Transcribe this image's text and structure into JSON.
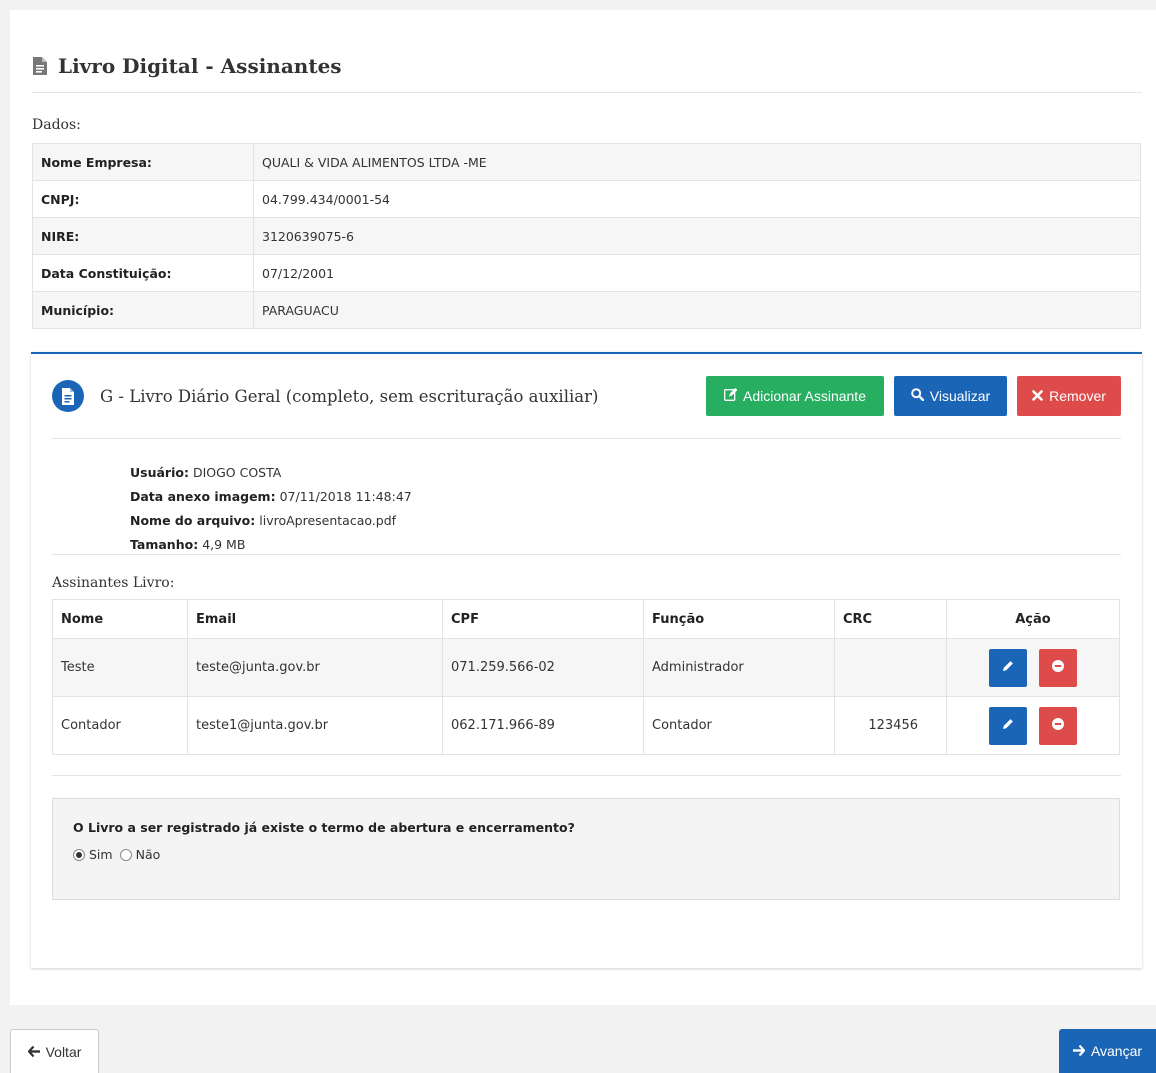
{
  "page": {
    "title": "Livro Digital - Assinantes"
  },
  "dados": {
    "label": "Dados:",
    "rows": [
      {
        "key": "Nome Empresa:",
        "value": "QUALI & VIDA ALIMENTOS LTDA -ME"
      },
      {
        "key": "CNPJ:",
        "value": "04.799.434/0001-54"
      },
      {
        "key": "NIRE:",
        "value": "3120639075-6"
      },
      {
        "key": "Data Constituição:",
        "value": "07/12/2001"
      },
      {
        "key": "Município:",
        "value": "PARAGUACU"
      }
    ]
  },
  "book": {
    "title": "G - Livro Diário Geral (completo, sem escrituração auxiliar)",
    "buttons": {
      "add": "Adicionar Assinante",
      "view": "Visualizar",
      "remove": "Remover"
    },
    "file": {
      "usuario_label": "Usuário:",
      "usuario": "DIOGO COSTA",
      "data_label": "Data anexo imagem:",
      "data": "07/11/2018 11:48:47",
      "arquivo_label": "Nome do arquivo:",
      "arquivo": "livroApresentacao.pdf",
      "tamanho_label": "Tamanho:",
      "tamanho": "4,9 MB"
    }
  },
  "assinantes": {
    "label": "Assinantes Livro:",
    "headers": {
      "nome": "Nome",
      "email": "Email",
      "cpf": "CPF",
      "funcao": "Função",
      "crc": "CRC",
      "acao": "Ação"
    },
    "rows": [
      {
        "nome": "Teste",
        "email": "teste@junta.gov.br",
        "cpf": "071.259.566-02",
        "funcao": "Administrador",
        "crc": ""
      },
      {
        "nome": "Contador",
        "email": "teste1@junta.gov.br",
        "cpf": "062.171.966-89",
        "funcao": "Contador",
        "crc": "123456"
      }
    ]
  },
  "termo": {
    "question": "O Livro a ser registrado já existe o termo de abertura e encerramento?",
    "options": [
      "Sim",
      "Não"
    ],
    "selected": "Sim"
  },
  "nav": {
    "back": "Voltar",
    "next": "Avançar"
  },
  "icons": {
    "title": "document-icon",
    "book": "file-text-icon",
    "add": "edit-icon",
    "view": "search-icon",
    "remove": "close-icon",
    "edit_row": "pencil-icon",
    "remove_row": "minus-circle-icon",
    "back": "arrow-left-icon",
    "next": "arrow-right-icon"
  },
  "colors": {
    "primary": "#1a65b6",
    "success": "#27ae60",
    "danger": "#dd4b4b"
  }
}
